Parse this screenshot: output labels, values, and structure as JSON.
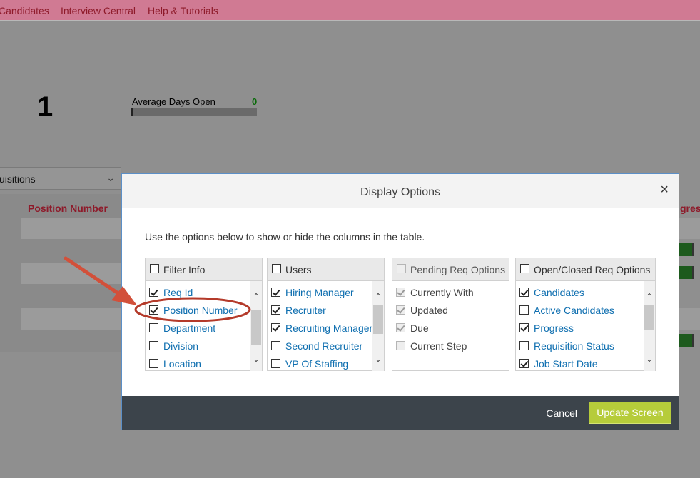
{
  "nav": {
    "items": [
      "Candidates",
      "Interview Central",
      "Help & Tutorials"
    ]
  },
  "dashboard": {
    "big_number": "1",
    "avg_days_label": "Average Days Open",
    "avg_days_value": "0",
    "requisition_select": "uisitions",
    "col_position": "Position Number",
    "col_progress": "gress"
  },
  "modal": {
    "title": "Display Options",
    "close_glyph": "×",
    "description": "Use the options below to show or hide the columns in the table.",
    "panels": [
      {
        "title": "Filter Info",
        "header_checked": false,
        "disabled": false,
        "items": [
          {
            "label": "Req Id",
            "checked": true
          },
          {
            "label": "Position Number",
            "checked": true
          },
          {
            "label": "Department",
            "checked": false
          },
          {
            "label": "Division",
            "checked": false
          },
          {
            "label": "Location",
            "checked": false
          }
        ]
      },
      {
        "title": "Users",
        "header_checked": false,
        "disabled": false,
        "items": [
          {
            "label": "Hiring Manager",
            "checked": true
          },
          {
            "label": "Recruiter",
            "checked": true
          },
          {
            "label": "Recruiting Manager",
            "checked": true
          },
          {
            "label": "Second Recruiter",
            "checked": false
          },
          {
            "label": "VP Of Staffing",
            "checked": false
          }
        ]
      },
      {
        "title": "Pending Req Options",
        "header_checked": false,
        "disabled": true,
        "items": [
          {
            "label": "Currently With",
            "checked": true
          },
          {
            "label": "Updated",
            "checked": true
          },
          {
            "label": "Due",
            "checked": true
          },
          {
            "label": "Current Step",
            "checked": false
          }
        ]
      },
      {
        "title": "Open/Closed Req Options",
        "header_checked": false,
        "disabled": false,
        "items": [
          {
            "label": "Candidates",
            "checked": true
          },
          {
            "label": "Active Candidates",
            "checked": false
          },
          {
            "label": "Progress",
            "checked": true
          },
          {
            "label": "Requisition Status",
            "checked": false
          },
          {
            "label": "Job Start Date",
            "checked": true
          }
        ]
      }
    ],
    "cancel_label": "Cancel",
    "update_label": "Update Screen"
  },
  "colors": {
    "accent_green": "#b6cc3a",
    "link_blue": "#0f6fb0",
    "footer_dark": "#3c444b",
    "annotation_red": "#c0392b"
  }
}
